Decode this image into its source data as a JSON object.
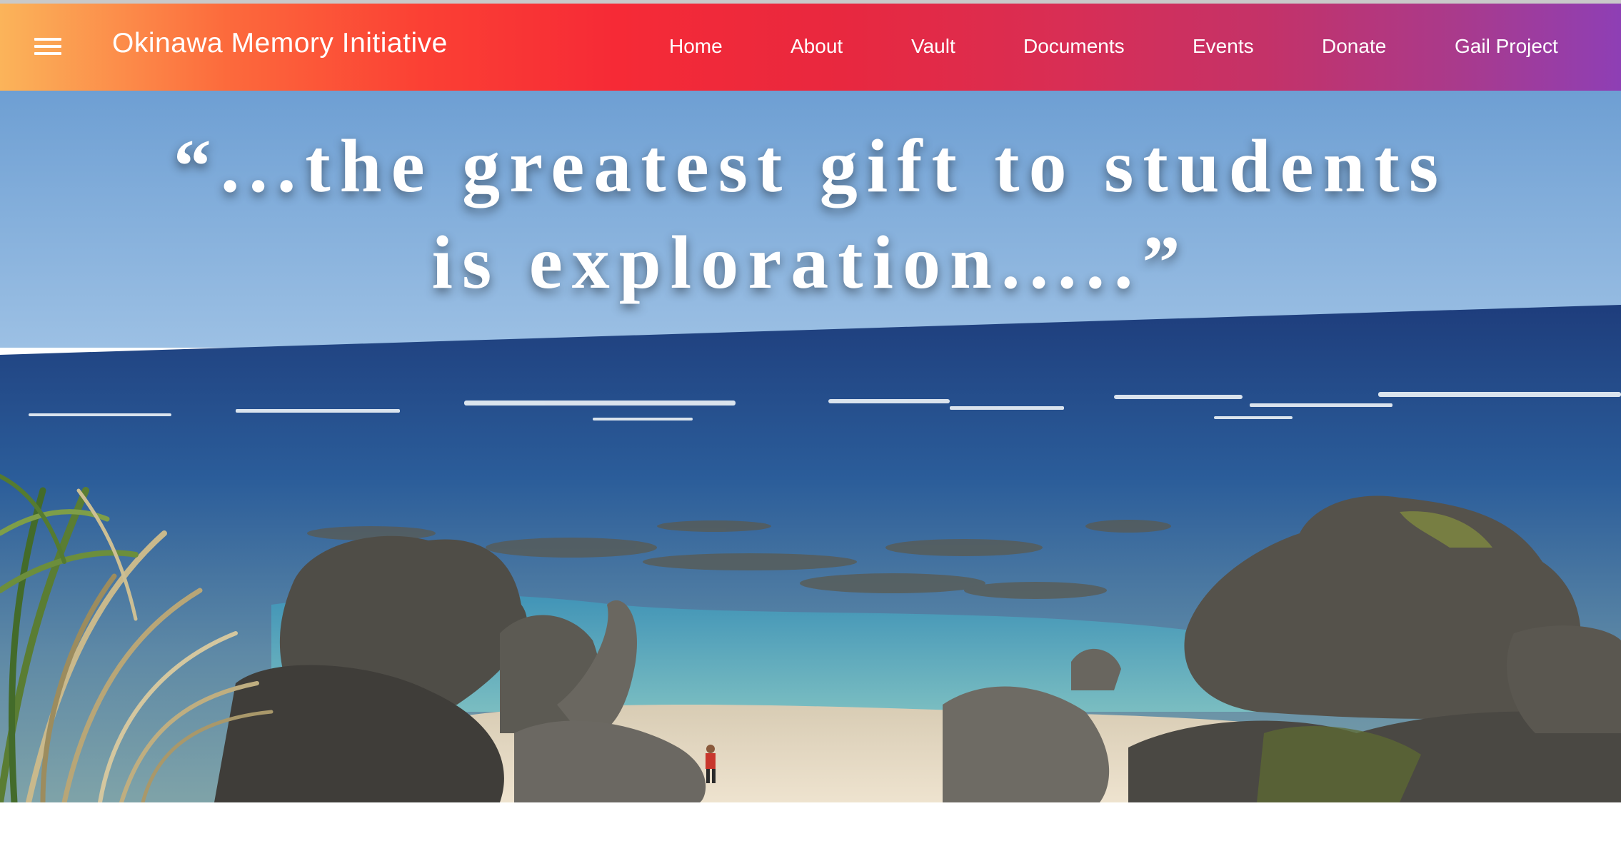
{
  "header": {
    "menu_icon": "hamburger-menu-icon",
    "site_title": "Okinawa Memory Initiative",
    "nav": [
      {
        "label": "Home"
      },
      {
        "label": "About"
      },
      {
        "label": "Vault"
      },
      {
        "label": "Documents"
      },
      {
        "label": "Events"
      },
      {
        "label": "Donate"
      },
      {
        "label": "Gail Project"
      }
    ],
    "gradient_colors": [
      "#fbb45a",
      "#fb4034",
      "#e8283f",
      "#c43268",
      "#8e3fb5"
    ]
  },
  "hero": {
    "quote_line_1": "“...the greatest gift to students",
    "quote_line_2": "is exploration.....”",
    "image_description_icon": "coastal-photo"
  }
}
